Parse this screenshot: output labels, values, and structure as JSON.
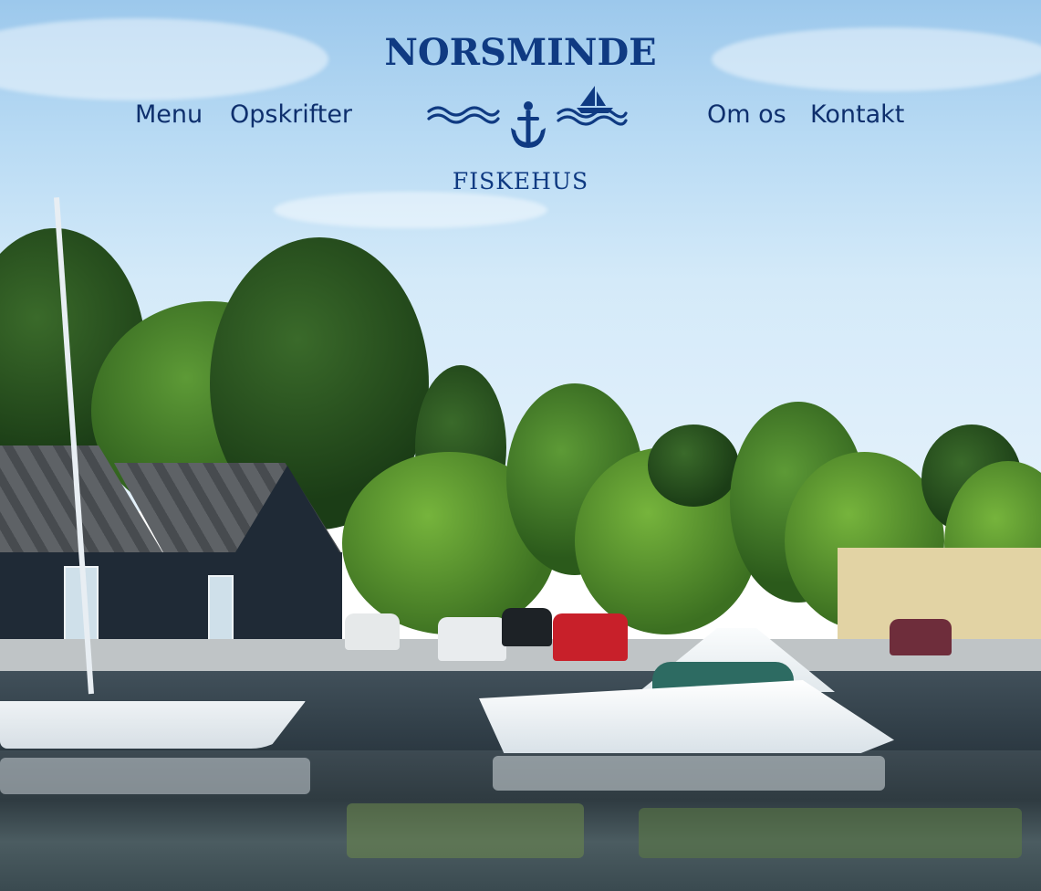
{
  "header": {
    "brand_title": "NORSMINDE",
    "brand_subtitle": "FISKEHUS",
    "logo_icon": "anchor-waves-sailboat-icon"
  },
  "nav": {
    "left": [
      {
        "label": "Menu"
      },
      {
        "label": "Opskrifter"
      }
    ],
    "right": [
      {
        "label": "Om os"
      },
      {
        "label": "Kontakt"
      }
    ]
  },
  "colors": {
    "brand_blue": "#0f3a82",
    "nav_text": "#0e2f6d"
  }
}
